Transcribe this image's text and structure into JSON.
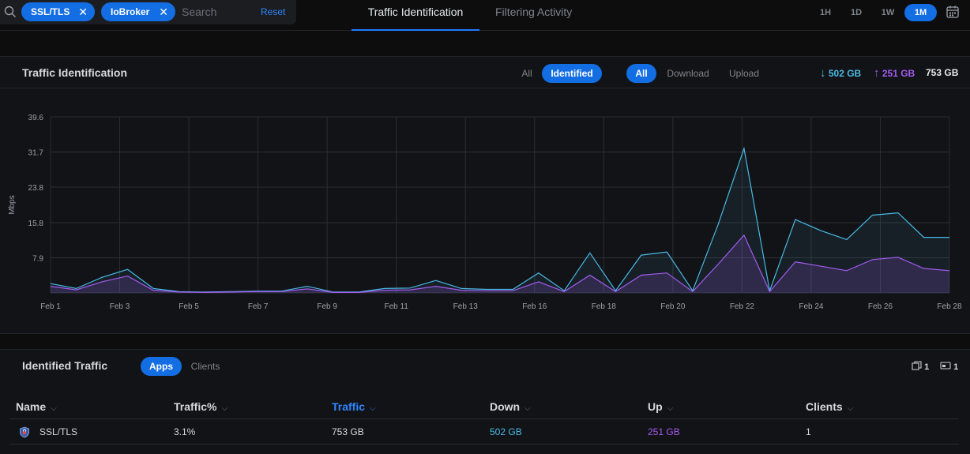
{
  "search": {
    "filters": [
      {
        "label": "SSL/TLS"
      },
      {
        "label": "IoBroker"
      }
    ],
    "placeholder": "Search",
    "reset_label": "Reset"
  },
  "tabs": [
    {
      "label": "Traffic Identification",
      "active": true
    },
    {
      "label": "Filtering Activity",
      "active": false
    }
  ],
  "time_ranges": [
    {
      "label": "1H",
      "active": false
    },
    {
      "label": "1D",
      "active": false
    },
    {
      "label": "1W",
      "active": false
    },
    {
      "label": "1M",
      "active": true
    }
  ],
  "traffic_panel": {
    "title": "Traffic Identification",
    "filter_toggle": [
      "All",
      "Identified"
    ],
    "filter_active": "Identified",
    "direction_toggle": [
      "All",
      "Download",
      "Upload"
    ],
    "direction_active": "All",
    "download_total": "502 GB",
    "upload_total": "251 GB",
    "total": "753 GB",
    "colors": {
      "download": "#49b9e6",
      "upload": "#a35bf0",
      "accent": "#136ee3"
    }
  },
  "chart_data": {
    "type": "area",
    "ylabel": "Mbps",
    "y_ticks": [
      "39.6",
      "31.7",
      "23.8",
      "15.8",
      "7.9"
    ],
    "ylim": [
      0,
      39.6
    ],
    "x_ticks": [
      "Feb 1",
      "Feb 3",
      "Feb 5",
      "Feb 7",
      "Feb 9",
      "Feb 11",
      "Feb 13",
      "Feb 16",
      "Feb 18",
      "Feb 20",
      "Feb 22",
      "Feb 24",
      "Feb 26",
      "Feb 28"
    ],
    "grid": true,
    "series": [
      {
        "values": [
          2.1,
          1.0,
          3.5,
          5.3,
          1.0,
          0.3,
          0.2,
          0.3,
          0.4,
          0.4,
          1.5,
          0.2,
          0.2,
          1.0,
          1.1,
          2.8,
          1.0,
          0.8,
          0.8,
          4.5,
          0.5,
          9.0,
          0.5,
          8.5,
          9.2,
          0.5,
          15.5,
          32.5,
          0.5,
          16.5,
          14.0,
          12.0,
          17.5,
          18.0,
          12.5,
          12.5
        ]
      },
      {
        "values": [
          1.5,
          0.7,
          2.5,
          3.8,
          0.6,
          0.2,
          0.1,
          0.2,
          0.3,
          0.3,
          0.9,
          0.1,
          0.1,
          0.6,
          0.7,
          1.5,
          0.6,
          0.5,
          0.5,
          2.5,
          0.3,
          4.0,
          0.3,
          4.0,
          4.5,
          0.3,
          6.5,
          13.0,
          0.3,
          7.0,
          6.0,
          5.0,
          7.5,
          8.0,
          5.5,
          5.0
        ]
      }
    ]
  },
  "identified_traffic": {
    "title": "Identified Traffic",
    "view_toggle": [
      "Apps",
      "Clients"
    ],
    "view_active": "Apps",
    "app_count": "1",
    "client_count": "1",
    "columns": [
      "Name",
      "Traffic%",
      "Traffic",
      "Down",
      "Up",
      "Clients"
    ],
    "sorted_column": "Traffic",
    "rows": [
      {
        "name": "SSL/TLS",
        "traffic_pct": "3.1%",
        "traffic": "753 GB",
        "down": "502 GB",
        "up": "251 GB",
        "clients": "1"
      }
    ]
  }
}
